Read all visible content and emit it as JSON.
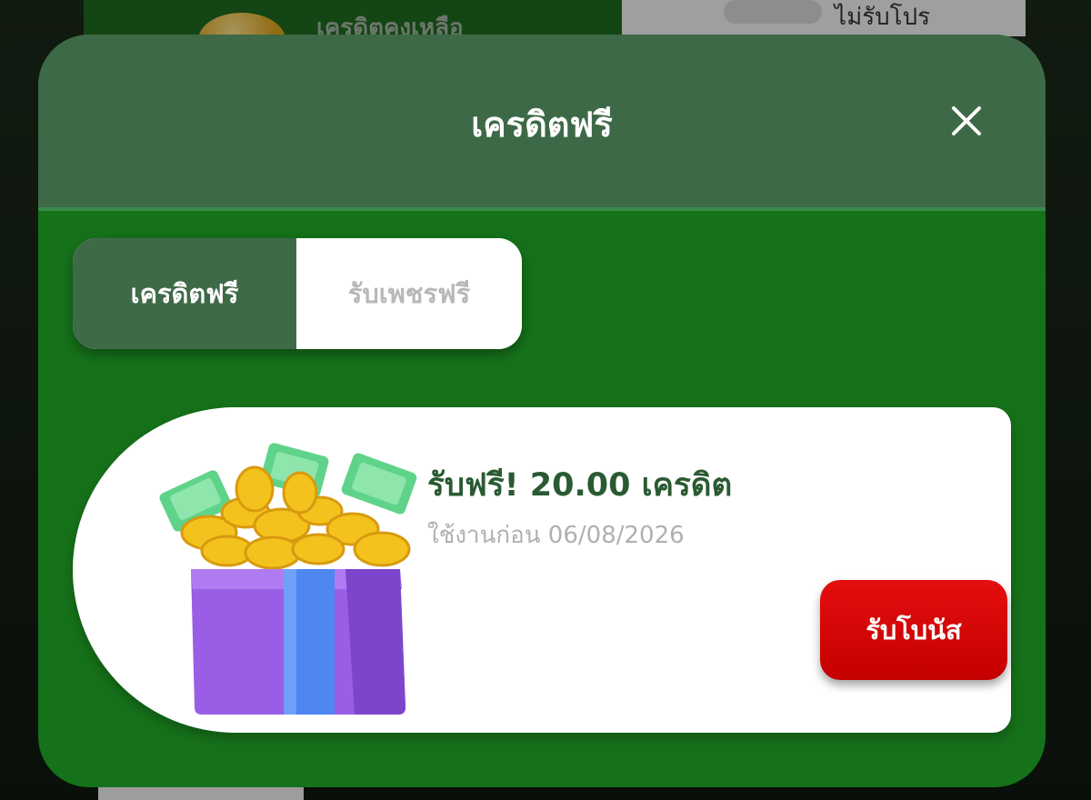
{
  "background": {
    "credit_label": "เครดิตคงเหลือ",
    "promo_label": "ไม่รับโปร"
  },
  "modal": {
    "title": "เครดิตฟรี",
    "close_icon": "close-icon"
  },
  "tabs": [
    {
      "label": "เครดิตฟรี",
      "active": true
    },
    {
      "label": "รับเพชรฟรี",
      "active": false
    }
  ],
  "offer": {
    "title": "รับฟรี! 20.00 เครดิต",
    "expiry": "ใช้งานก่อน 06/08/2026",
    "button_label": "รับโบนัส",
    "image_icon": "gift-box-coins-icon"
  },
  "colors": {
    "header": "#3d6947",
    "body": "#16721a",
    "tab_active": "#3f6a48",
    "button": "#d80808",
    "title_text": "#2a5a32"
  }
}
